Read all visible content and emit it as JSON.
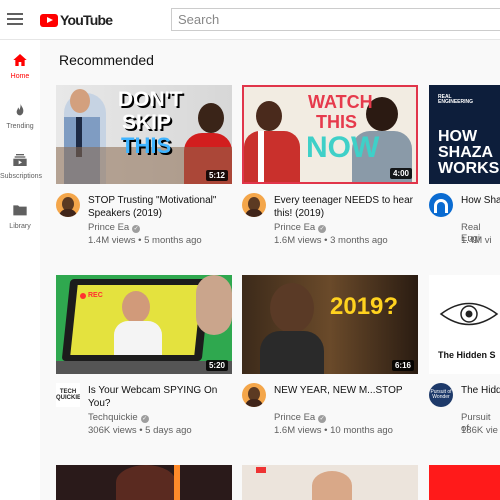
{
  "header": {
    "logo_text": "YouTube",
    "search_placeholder": "Search"
  },
  "sidebar": {
    "items": [
      {
        "label": "Home",
        "icon": "home-icon",
        "active": true
      },
      {
        "label": "Trending",
        "icon": "flame-icon",
        "active": false
      },
      {
        "label": "Subscriptions",
        "icon": "subscriptions-icon",
        "active": false
      },
      {
        "label": "Library",
        "icon": "folder-icon",
        "active": false
      }
    ]
  },
  "main": {
    "section_title": "Recommended",
    "videos": [
      {
        "title": "STOP Trusting \"Motivational\" Speakers (2019)",
        "channel": "Prince Ea",
        "verified": true,
        "meta": "1.4M views • 5 months ago",
        "duration": "5:12",
        "thumb_text_1": "DON'T",
        "thumb_text_2": "SKIP",
        "thumb_text_3": "THIS"
      },
      {
        "title": "Every teenager NEEDS to hear this! (2019)",
        "channel": "Prince Ea",
        "verified": true,
        "meta": "1.6M views • 3 months ago",
        "duration": "4:00",
        "thumb_text_1": "WATCH",
        "thumb_text_2": "THIS",
        "thumb_text_3": "NOW"
      },
      {
        "title": "How Shaz",
        "channel": "Real Engi",
        "verified": false,
        "meta": "1.4M vi",
        "duration": "",
        "thumb_text_0": "REAL ENGINEERING",
        "thumb_text_1": "HOW",
        "thumb_text_2": "SHAZA",
        "thumb_text_3": "WORKS"
      },
      {
        "title": "Is Your Webcam SPYING On You?",
        "channel": "Techquickie",
        "verified": true,
        "meta": "306K views • 5 days ago",
        "duration": "5:20",
        "thumb_text_1": "REC",
        "avatar_text": "TECH QUICKIE"
      },
      {
        "title": "NEW YEAR, NEW M...STOP",
        "channel": "Prince Ea",
        "verified": true,
        "meta": "1.6M views • 10 months ago",
        "duration": "6:16",
        "thumb_text_1": "2019?"
      },
      {
        "title": "The Hidd Person",
        "channel": "Pursuit of",
        "verified": false,
        "meta": "186K vie",
        "duration": "",
        "thumb_text_1": "The Hidden S",
        "avatar_text": "Pursuit of Wonder"
      }
    ]
  }
}
